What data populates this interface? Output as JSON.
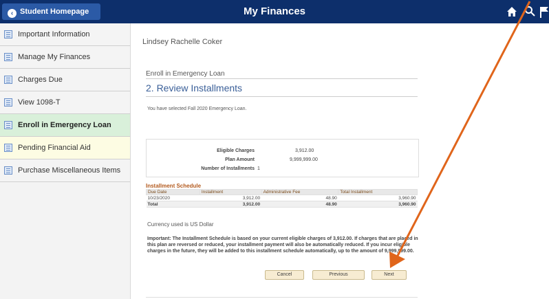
{
  "header": {
    "back_label": "Student Homepage",
    "title": "My Finances"
  },
  "sidebar": {
    "items": [
      {
        "label": "Important Information"
      },
      {
        "label": "Manage My Finances"
      },
      {
        "label": "Charges Due"
      },
      {
        "label": "View 1098-T"
      },
      {
        "label": "Enroll in Emergency Loan"
      },
      {
        "label": "Pending Financial Aid"
      },
      {
        "label": "Purchase Miscellaneous Items"
      }
    ]
  },
  "main": {
    "student_name": "Lindsey Rachelle Coker",
    "section": "Enroll in Emergency Loan",
    "step_title": "2. Review Installments",
    "selected_text": "You have selected Fall 2020 Emergency Loan.",
    "summary": {
      "eligible_charges_label": "Eligible Charges",
      "eligible_charges_value": "3,912.00",
      "plan_amount_label": "Plan Amount",
      "plan_amount_value": "9,999,999.00",
      "installments_label": "Number of Installments",
      "installments_value": "1"
    },
    "schedule": {
      "title": "Installment Schedule",
      "headers": [
        "Due Date",
        "Installment",
        "Administrative Fee",
        "Total Installment"
      ],
      "rows": [
        [
          "10/23/2020",
          "3,912.00",
          "48.90",
          "3,960.90"
        ]
      ],
      "total": [
        "Total",
        "3,912.00",
        "48.90",
        "3,960.90"
      ]
    },
    "currency": "Currency used is US Dollar",
    "important_label": "Important:",
    "important_text": "The Installment Schedule is based on your current eligible charges of 3,912.00.  If charges that are placed in this plan are reversed or reduced, your installment payment will also be automatically reduced.  If you incur eligible charges in the future, they will be added to this installment schedule automatically, up to the amount of 9,999,999.00.",
    "buttons": {
      "cancel": "Cancel",
      "previous": "Previous",
      "next": "Next"
    }
  },
  "colors": {
    "header_bg": "#0d2f6b",
    "accent_blue": "#3a5f98",
    "active_item_bg": "#d9f0da",
    "annotation_arrow": "#e0651b"
  },
  "icons": [
    "home-icon",
    "search-icon",
    "flag-icon",
    "chevron-left-icon",
    "document-icon"
  ]
}
